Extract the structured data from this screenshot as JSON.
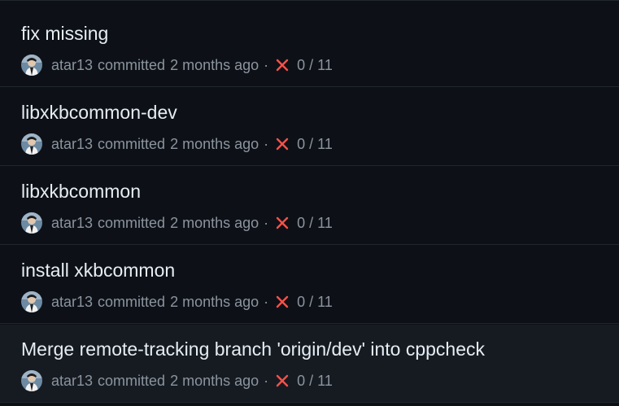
{
  "colors": {
    "background": "#0d1117",
    "hover_background": "#161b22",
    "title_text": "#e6edf3",
    "muted_text": "#8b949e",
    "divider": "#21262d",
    "failure_icon": "#f85149"
  },
  "commits": [
    {
      "title": "fix missing",
      "author": "atar13",
      "verb": "committed",
      "time": "2 months ago",
      "separator": "·",
      "status_icon": "x-icon",
      "checks": "0 / 11"
    },
    {
      "title": "libxkbcommon-dev",
      "author": "atar13",
      "verb": "committed",
      "time": "2 months ago",
      "separator": "·",
      "status_icon": "x-icon",
      "checks": "0 / 11"
    },
    {
      "title": "libxkbcommon",
      "author": "atar13",
      "verb": "committed",
      "time": "2 months ago",
      "separator": "·",
      "status_icon": "x-icon",
      "checks": "0 / 11"
    },
    {
      "title": "install xkbcommon",
      "author": "atar13",
      "verb": "committed",
      "time": "2 months ago",
      "separator": "·",
      "status_icon": "x-icon",
      "checks": "0 / 11"
    },
    {
      "title": "Merge remote-tracking branch 'origin/dev' into cppcheck",
      "author": "atar13",
      "verb": "committed",
      "time": "2 months ago",
      "separator": "·",
      "status_icon": "x-icon",
      "checks": "0 / 11"
    }
  ]
}
